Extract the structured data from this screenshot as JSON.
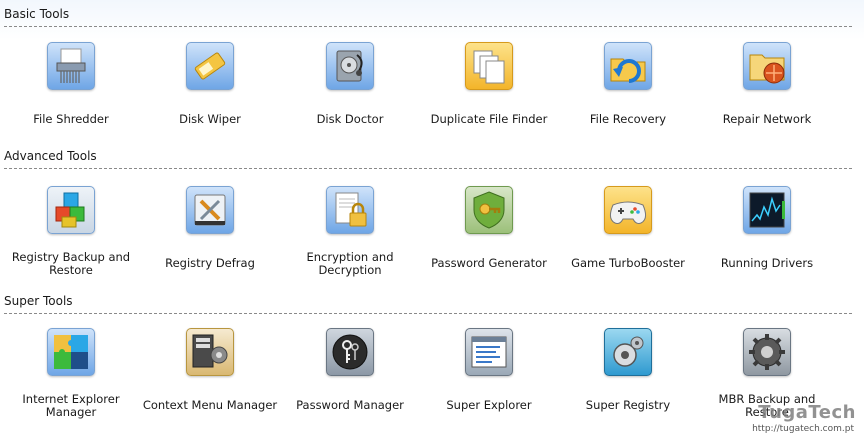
{
  "sections": [
    {
      "title": "Basic Tools",
      "tools": [
        {
          "label": "File Shredder",
          "icon": "file-shredder-icon"
        },
        {
          "label": "Disk Wiper",
          "icon": "disk-wiper-icon"
        },
        {
          "label": "Disk Doctor",
          "icon": "disk-doctor-icon"
        },
        {
          "label": "Duplicate File Finder",
          "icon": "duplicate-file-finder-icon"
        },
        {
          "label": "File Recovery",
          "icon": "file-recovery-icon"
        },
        {
          "label": "Repair Network",
          "icon": "repair-network-icon"
        }
      ]
    },
    {
      "title": "Advanced Tools",
      "tools": [
        {
          "label": "Registry Backup and Restore",
          "icon": "registry-backup-icon"
        },
        {
          "label": "Registry Defrag",
          "icon": "registry-defrag-icon"
        },
        {
          "label": "Encryption and Decryption",
          "icon": "encryption-icon"
        },
        {
          "label": "Password Generator",
          "icon": "password-generator-icon"
        },
        {
          "label": "Game TurboBooster",
          "icon": "gamepad-icon"
        },
        {
          "label": "Running Drivers",
          "icon": "running-drivers-icon"
        }
      ]
    },
    {
      "title": "Super Tools",
      "tools": [
        {
          "label": "Internet Explorer Manager",
          "icon": "puzzle-icon"
        },
        {
          "label": "Context Menu Manager",
          "icon": "context-menu-icon"
        },
        {
          "label": "Password Manager",
          "icon": "keys-icon"
        },
        {
          "label": "Super Explorer",
          "icon": "super-explorer-icon"
        },
        {
          "label": "Super Registry",
          "icon": "super-registry-icon"
        },
        {
          "label": "MBR Backup and Restore",
          "icon": "mbr-gear-icon"
        }
      ]
    }
  ],
  "watermark": {
    "logo": "TugaTech",
    "url": "http://tugatech.com.pt"
  },
  "colors": {
    "accent_blue": "#3a78c8",
    "border_blue": "#7aa3d3",
    "divider": "#8a8a8a"
  }
}
